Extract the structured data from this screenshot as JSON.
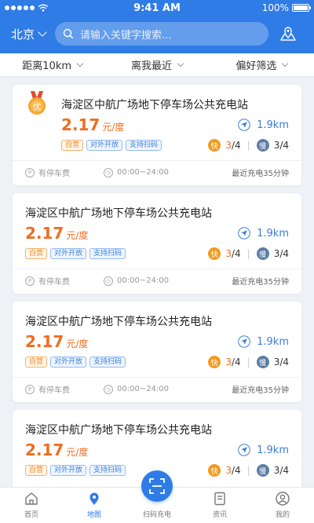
{
  "status_bar": {
    "time": "9:41 AM",
    "battery": "100%"
  },
  "header": {
    "city": "北京",
    "search_placeholder": "请输入关键字搜索..."
  },
  "filters": [
    {
      "label": "距离10km"
    },
    {
      "label": "离我最近"
    },
    {
      "label": "偏好筛选"
    }
  ],
  "medal_label": "优",
  "stations": [
    {
      "name": "海淀区中航广场地下停车场公共充电站",
      "price": "2.17",
      "unit": "元/度",
      "distance": "1.9km",
      "tags": [
        "自营",
        "对外开放",
        "支持扫码"
      ],
      "fast_label": "快",
      "fast_avail": "3",
      "fast_total": "/4",
      "slow_label": "慢",
      "slow_count": "3/4",
      "parking": "有停车费",
      "hours": "00:00~24:00",
      "recent": "最近充电35分钟"
    },
    {
      "name": "海淀区中航广场地下停车场公共充电站",
      "price": "2.17",
      "unit": "元/度",
      "distance": "1.9km",
      "tags": [
        "自营",
        "对外开放",
        "支持扫码"
      ],
      "fast_label": "快",
      "fast_avail": "3",
      "fast_total": "/4",
      "slow_label": "慢",
      "slow_count": "3/4",
      "parking": "有停车费",
      "hours": "00:00~24:00",
      "recent": "最近充电35分钟"
    },
    {
      "name": "海淀区中航广场地下停车场公共充电站",
      "price": "2.17",
      "unit": "元/度",
      "distance": "1.9km",
      "tags": [
        "自营",
        "对外开放",
        "支持扫码"
      ],
      "fast_label": "快",
      "fast_avail": "3",
      "fast_total": "/4",
      "slow_label": "慢",
      "slow_count": "3/4",
      "parking": "有停车费",
      "hours": "00:00~24:00",
      "recent": "最近充电35分钟"
    },
    {
      "name": "海淀区中航广场地下停车场公共充电站",
      "price": "2.17",
      "unit": "元/度",
      "distance": "1.9km",
      "tags": [
        "自营",
        "对外开放",
        "支持扫码"
      ],
      "fast_label": "快",
      "fast_avail": "3",
      "fast_total": "/4",
      "slow_label": "慢",
      "slow_count": "3/4"
    }
  ],
  "tabs": [
    {
      "label": "首页"
    },
    {
      "label": "地图"
    },
    {
      "label": "扫码充电"
    },
    {
      "label": "资讯"
    },
    {
      "label": "我的"
    }
  ],
  "colors": {
    "primary": "#2f7ce6",
    "price": "#ef6d1f",
    "fast": "#f39a1e",
    "slow": "#5b7da5"
  }
}
